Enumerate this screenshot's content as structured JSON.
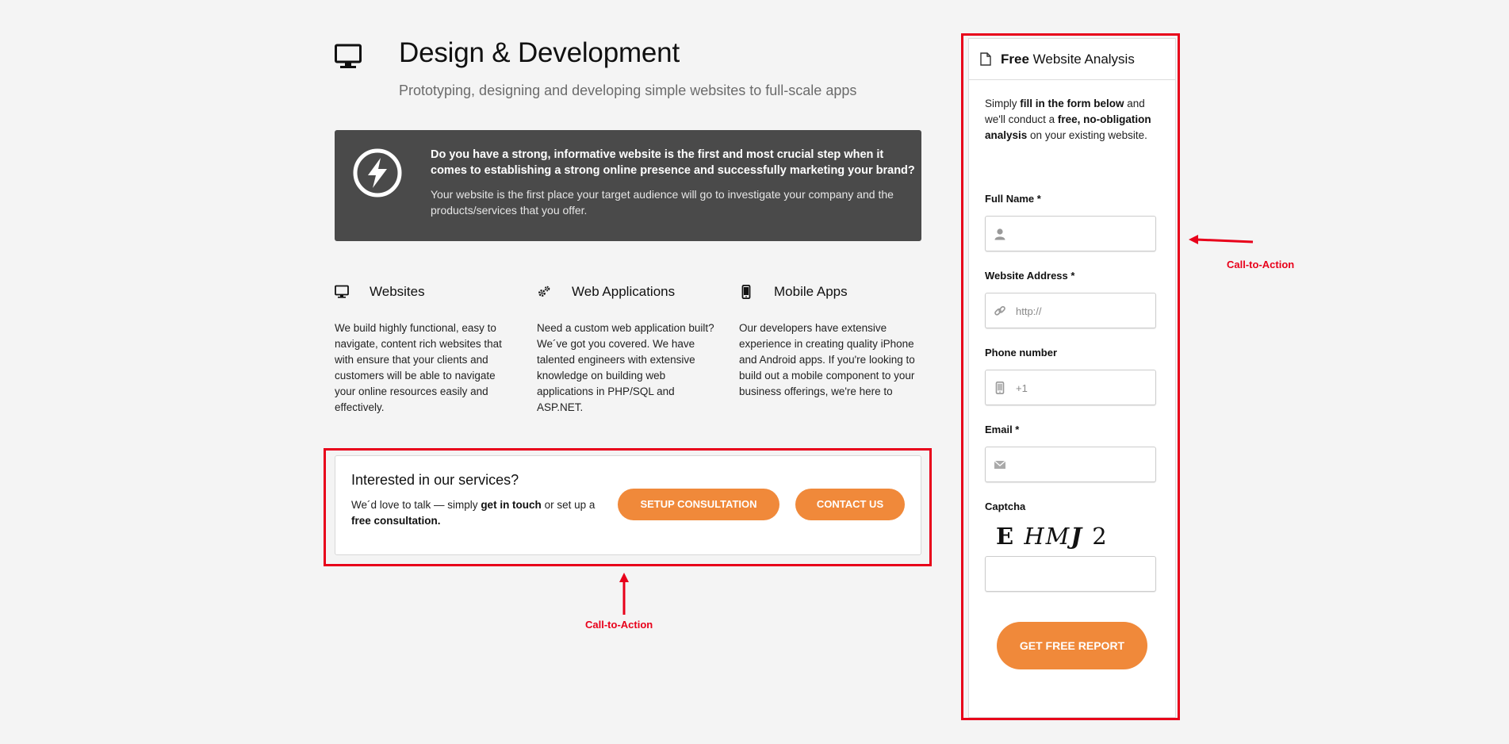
{
  "header": {
    "title": "Design & Development",
    "subtitle": "Prototyping, designing and developing simple websites to full-scale apps",
    "icon": "monitor-icon"
  },
  "info_box": {
    "icon": "lightning-bolt-icon",
    "question": "Do you have a strong, informative website is the first and most crucial step when it comes to establishing a strong online presence and successfully marketing your brand?",
    "answer": "Your website is the first place your target audience will go to investigate your company and the products/services that you offer."
  },
  "services": [
    {
      "icon": "monitor-icon",
      "title": "Websites",
      "description": "We build highly functional, easy to navigate, content rich websites that with ensure that your clients and customers will be able to navigate your online resources easily and effectively."
    },
    {
      "icon": "gears-icon",
      "title": "Web Applications",
      "description": "Need a custom web application built? We´ve got you covered. We have talented engineers with extensive knowledge on building web applications in PHP/SQL and ASP.NET."
    },
    {
      "icon": "mobile-phone-icon",
      "title": "Mobile Apps",
      "description": "Our developers have extensive experience in creating quality iPhone and Android apps. If you're looking to build out a mobile component to your business offerings, we're here to"
    }
  ],
  "cta": {
    "title": "Interested in our services?",
    "text_1": "We´d love to talk — simply ",
    "text_bold_1": "get in touch",
    "text_2": " or set up a ",
    "text_bold_2": "free consultation.",
    "setup_label": "SETUP CONSULTATION",
    "contact_label": "CONTACT US",
    "annotation": "Call-to-Action"
  },
  "side_form": {
    "head_bold": "Free",
    "head_rest": " Website Analysis",
    "head_icon": "document-icon",
    "intro_1": "Simply ",
    "intro_bold_1": "fill in the form below",
    "intro_2": " and we'll conduct a ",
    "intro_bold_2": "free, no-obligation analysis",
    "intro_3": " on your existing website.",
    "fields": {
      "full_name": {
        "label": "Full Name *",
        "value": "",
        "placeholder": "",
        "icon": "user-icon"
      },
      "website": {
        "label": "Website Address *",
        "value": "",
        "placeholder": "http://",
        "icon": "link-icon"
      },
      "phone": {
        "label": "Phone number",
        "value": "",
        "placeholder": "+1",
        "icon": "mobile-phone-icon"
      },
      "email": {
        "label": "Email *",
        "value": "",
        "placeholder": "",
        "icon": "envelope-icon"
      },
      "captcha": {
        "label": "Captcha",
        "value": "",
        "placeholder": ""
      }
    },
    "captcha_chars": [
      "E",
      "HM",
      "J",
      "2"
    ],
    "submit_label": "GET FREE REPORT",
    "annotation": "Call-to-Action"
  },
  "colors": {
    "accent": "#f0893a",
    "annotation_red": "#e8001a",
    "dark_box": "#4a4a4a",
    "background": "#f4f4f4"
  }
}
